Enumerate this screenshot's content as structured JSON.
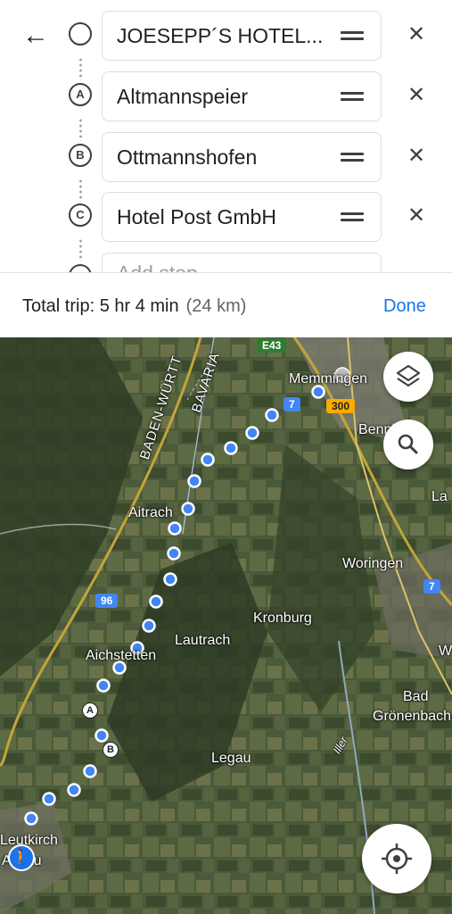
{
  "header": {
    "back_label": "←",
    "stops": [
      {
        "marker": "",
        "value": "JOESEPP´S HOTEL..."
      },
      {
        "marker": "A",
        "value": "Altmannspeier"
      },
      {
        "marker": "B",
        "value": "Ottmannshofen"
      },
      {
        "marker": "C",
        "value": "Hotel Post GmbH"
      },
      {
        "marker": "",
        "value": "Add stop"
      }
    ],
    "close_label": "✕"
  },
  "trip": {
    "label": "Total trip: 5 hr 4 min",
    "distance": "(24 km)",
    "done": "Done"
  },
  "map": {
    "places": [
      "Memmingen",
      "Benningen",
      "Aitrach",
      "Woringen",
      "Kronburg",
      "Lautrach",
      "Aichstetten",
      "Legau",
      "Bad",
      "Grönenbach",
      "Leutkirch",
      "Allgäu",
      "La",
      "W",
      "Iller"
    ],
    "regions": [
      "BADEN-WÜRTT",
      "BAVARIA"
    ],
    "roads": [
      "E43",
      "7",
      "300",
      "96",
      "7"
    ],
    "route_markers": [
      "A",
      "B"
    ],
    "colors": {
      "route": "#4285f4",
      "accent": "#1a73e8",
      "green_shield": "#2e7d32",
      "yellow_shield": "#f9ab00"
    }
  }
}
